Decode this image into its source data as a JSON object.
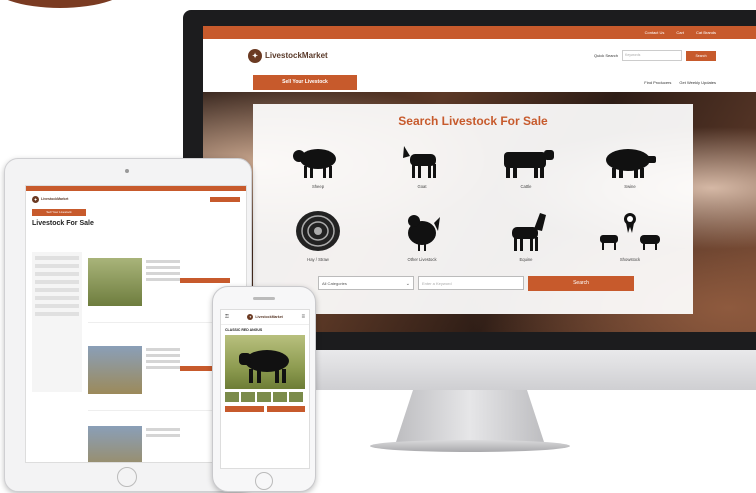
{
  "colors": {
    "brand": "#c75a2c",
    "dark": "#1c1c1e",
    "logo": "#6b3a22"
  },
  "monitor": {
    "topbar": {
      "links": [
        "Contact Us",
        "Cart",
        "Cat Brands"
      ]
    },
    "logo_text": "LivestockMarket",
    "search_label": "Quick Search",
    "search_placeholder": "Keywords",
    "search_button": "Search",
    "sell_button": "Sell Your Livestock",
    "nav_links": [
      "Find Producers",
      "Get Weekly Updates"
    ],
    "panel_title": "Search Livestock For Sale",
    "categories": [
      {
        "label": "Sheep",
        "icon": "sheep-icon"
      },
      {
        "label": "Goat",
        "icon": "goat-icon"
      },
      {
        "label": "Cattle",
        "icon": "cattle-icon"
      },
      {
        "label": "Swine",
        "icon": "swine-icon"
      },
      {
        "label": "Hay / Straw",
        "icon": "hay-bale-icon"
      },
      {
        "label": "Other Livestock",
        "icon": "chicken-icon"
      },
      {
        "label": "Equine",
        "icon": "horse-icon"
      },
      {
        "label": "Showstock",
        "icon": "showstock-icon"
      }
    ],
    "category_select": "All Categories",
    "keyword_placeholder": "Enter a Keyword",
    "search_submit": "Search"
  },
  "tablet": {
    "logo_text": "LivestockMarket",
    "sell_button": "Sell Your Livestock",
    "page_title": "Livestock For Sale"
  },
  "phone": {
    "logo_text": "LivestockMarket",
    "listing_title": "CLASSIC RED ANGUS"
  }
}
